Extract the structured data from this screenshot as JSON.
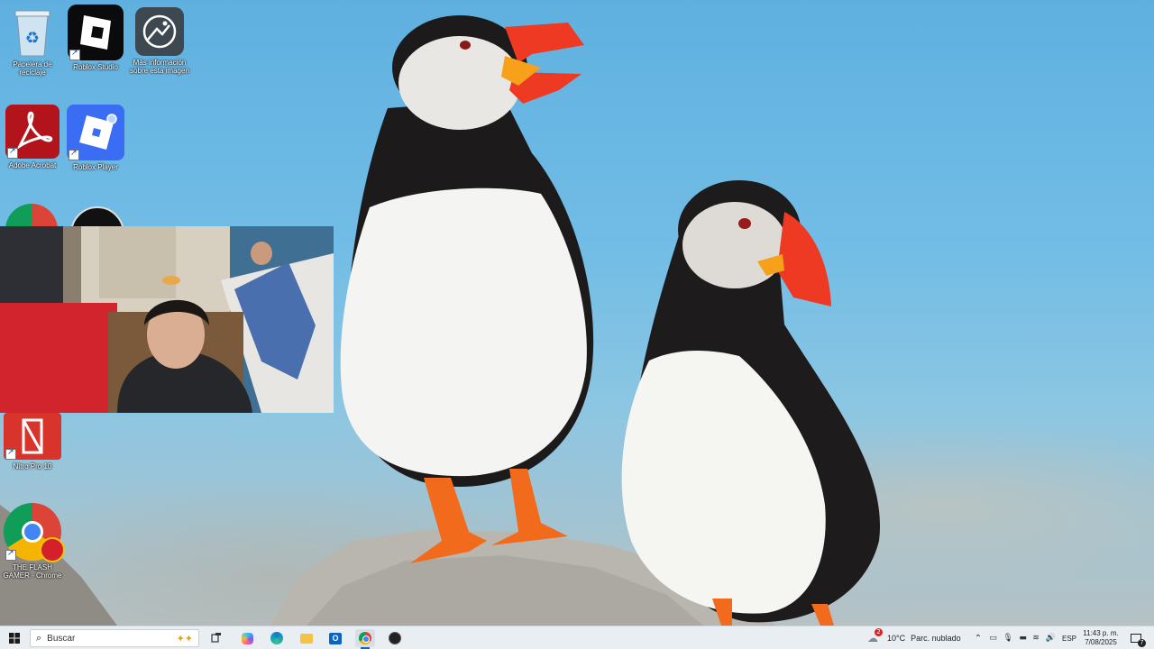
{
  "desktop": {
    "icons": [
      {
        "label": "Papelera de reciclaje",
        "icon": "recycle-bin-icon"
      },
      {
        "label": "Roblox Studio",
        "icon": "roblox-studio-icon"
      },
      {
        "label": "Más información sobre esta imagen",
        "icon": "image-info-icon"
      },
      {
        "label": "Adobe Acrobat",
        "icon": "adobe-acrobat-icon"
      },
      {
        "label": "Roblox Player",
        "icon": "roblox-player-icon"
      },
      {
        "label": "Nitro Pro 10",
        "icon": "nitro-pro-icon"
      },
      {
        "label": "THE FLASH GAMER - Chrome",
        "icon": "chrome-profile-icon"
      }
    ]
  },
  "taskbar": {
    "search_placeholder": "Buscar",
    "weather": {
      "temp": "10°C",
      "condition": "Parc. nublado",
      "badge": "2"
    },
    "language": "ESP",
    "clock": {
      "time": "11:43 p. m.",
      "date": "7/08/2025"
    },
    "notification_count": "7"
  },
  "colors": {
    "taskbar_bg": "#e9eef3",
    "sky": "#72bde6",
    "acrobat_red": "#c8161d",
    "roblox_blue": "#3a6cf4",
    "puffin_beak": "#ee3a22"
  }
}
